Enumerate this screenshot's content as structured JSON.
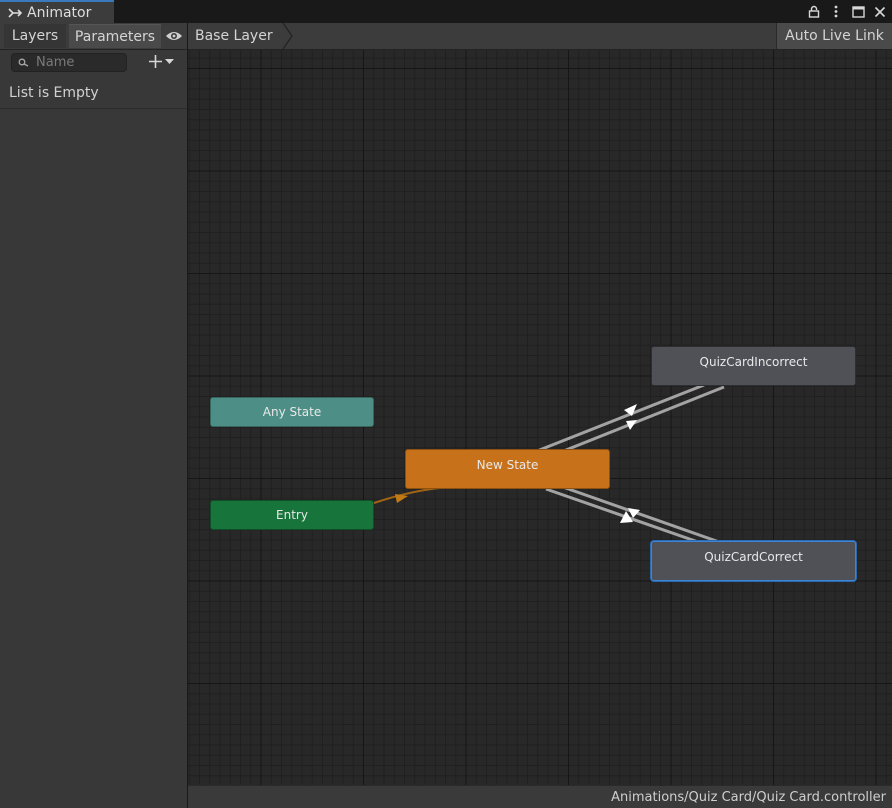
{
  "window": {
    "title": "Animator",
    "controls": [
      "lock-icon",
      "kebab-menu-icon",
      "maximize-icon",
      "close-icon"
    ]
  },
  "left_panel": {
    "tabs": [
      {
        "label": "Layers"
      },
      {
        "label": "Parameters",
        "selected": true
      }
    ],
    "search": {
      "placeholder": "Name",
      "value": ""
    },
    "empty_text": "List is Empty"
  },
  "graph": {
    "breadcrumb": "Base Layer",
    "auto_live_link": "Auto Live Link",
    "states": {
      "any_state": "Any State",
      "entry": "Entry",
      "new_state": "New State",
      "incorrect": "QuizCardIncorrect",
      "correct": "QuizCardCorrect"
    },
    "colors": {
      "any_state": "#4d8f86",
      "entry": "#17743a",
      "default_state": "#c7721a",
      "state": "#4f5157",
      "selection": "#3c84d6"
    }
  },
  "status": {
    "path": "Animations/Quiz Card/Quiz Card.controller"
  }
}
